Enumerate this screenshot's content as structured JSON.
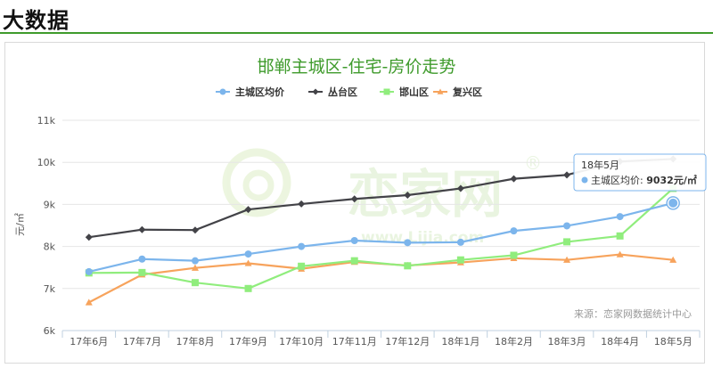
{
  "page": {
    "section_title": "大数据"
  },
  "chart_data": {
    "type": "line",
    "title": "邯郸主城区-住宅-房价走势",
    "ylabel": "元/㎡",
    "ylim": [
      6000,
      11000
    ],
    "yticks": [
      {
        "value": 6000,
        "label": "6k"
      },
      {
        "value": 7000,
        "label": "7k"
      },
      {
        "value": 8000,
        "label": "8k"
      },
      {
        "value": 9000,
        "label": "9k"
      },
      {
        "value": 10000,
        "label": "10k"
      },
      {
        "value": 11000,
        "label": "11k"
      }
    ],
    "grid": true,
    "legend": "top-center",
    "categories": [
      "17年6月",
      "17年7月",
      "17年8月",
      "17年9月",
      "17年10月",
      "17年11月",
      "17年12月",
      "18年1月",
      "18年2月",
      "18年3月",
      "18年4月",
      "18年5月"
    ],
    "series": [
      {
        "name": "主城区均价",
        "color": "#7cb5ec",
        "marker": "circle",
        "values": [
          7400,
          7700,
          7660,
          7820,
          8000,
          8140,
          8090,
          8100,
          8370,
          8490,
          8710,
          9032
        ]
      },
      {
        "name": "丛台区",
        "color": "#434348",
        "marker": "diamond",
        "values": [
          8220,
          8400,
          8390,
          8880,
          9010,
          9130,
          9220,
          9380,
          9610,
          9700,
          10020,
          10080
        ]
      },
      {
        "name": "邯山区",
        "color": "#90ed7d",
        "marker": "square",
        "values": [
          7370,
          7380,
          7140,
          7000,
          7530,
          7660,
          7540,
          7680,
          7790,
          8110,
          8250,
          9380
        ]
      },
      {
        "name": "复兴区",
        "color": "#f7a35c",
        "marker": "triangle",
        "values": [
          6670,
          7330,
          7490,
          7600,
          7470,
          7630,
          7550,
          7620,
          7720,
          7680,
          7810,
          7680
        ]
      }
    ],
    "tooltip": {
      "title": "18年5月",
      "series_label": "主城区均价: ",
      "value_text": "9032元/㎡",
      "series_index": 0,
      "category_index": 11
    },
    "watermark": {
      "main": "恋家网",
      "sub": "www.Lijia.com",
      "mark": "®"
    },
    "source": "来源：恋家网数据统计中心"
  }
}
